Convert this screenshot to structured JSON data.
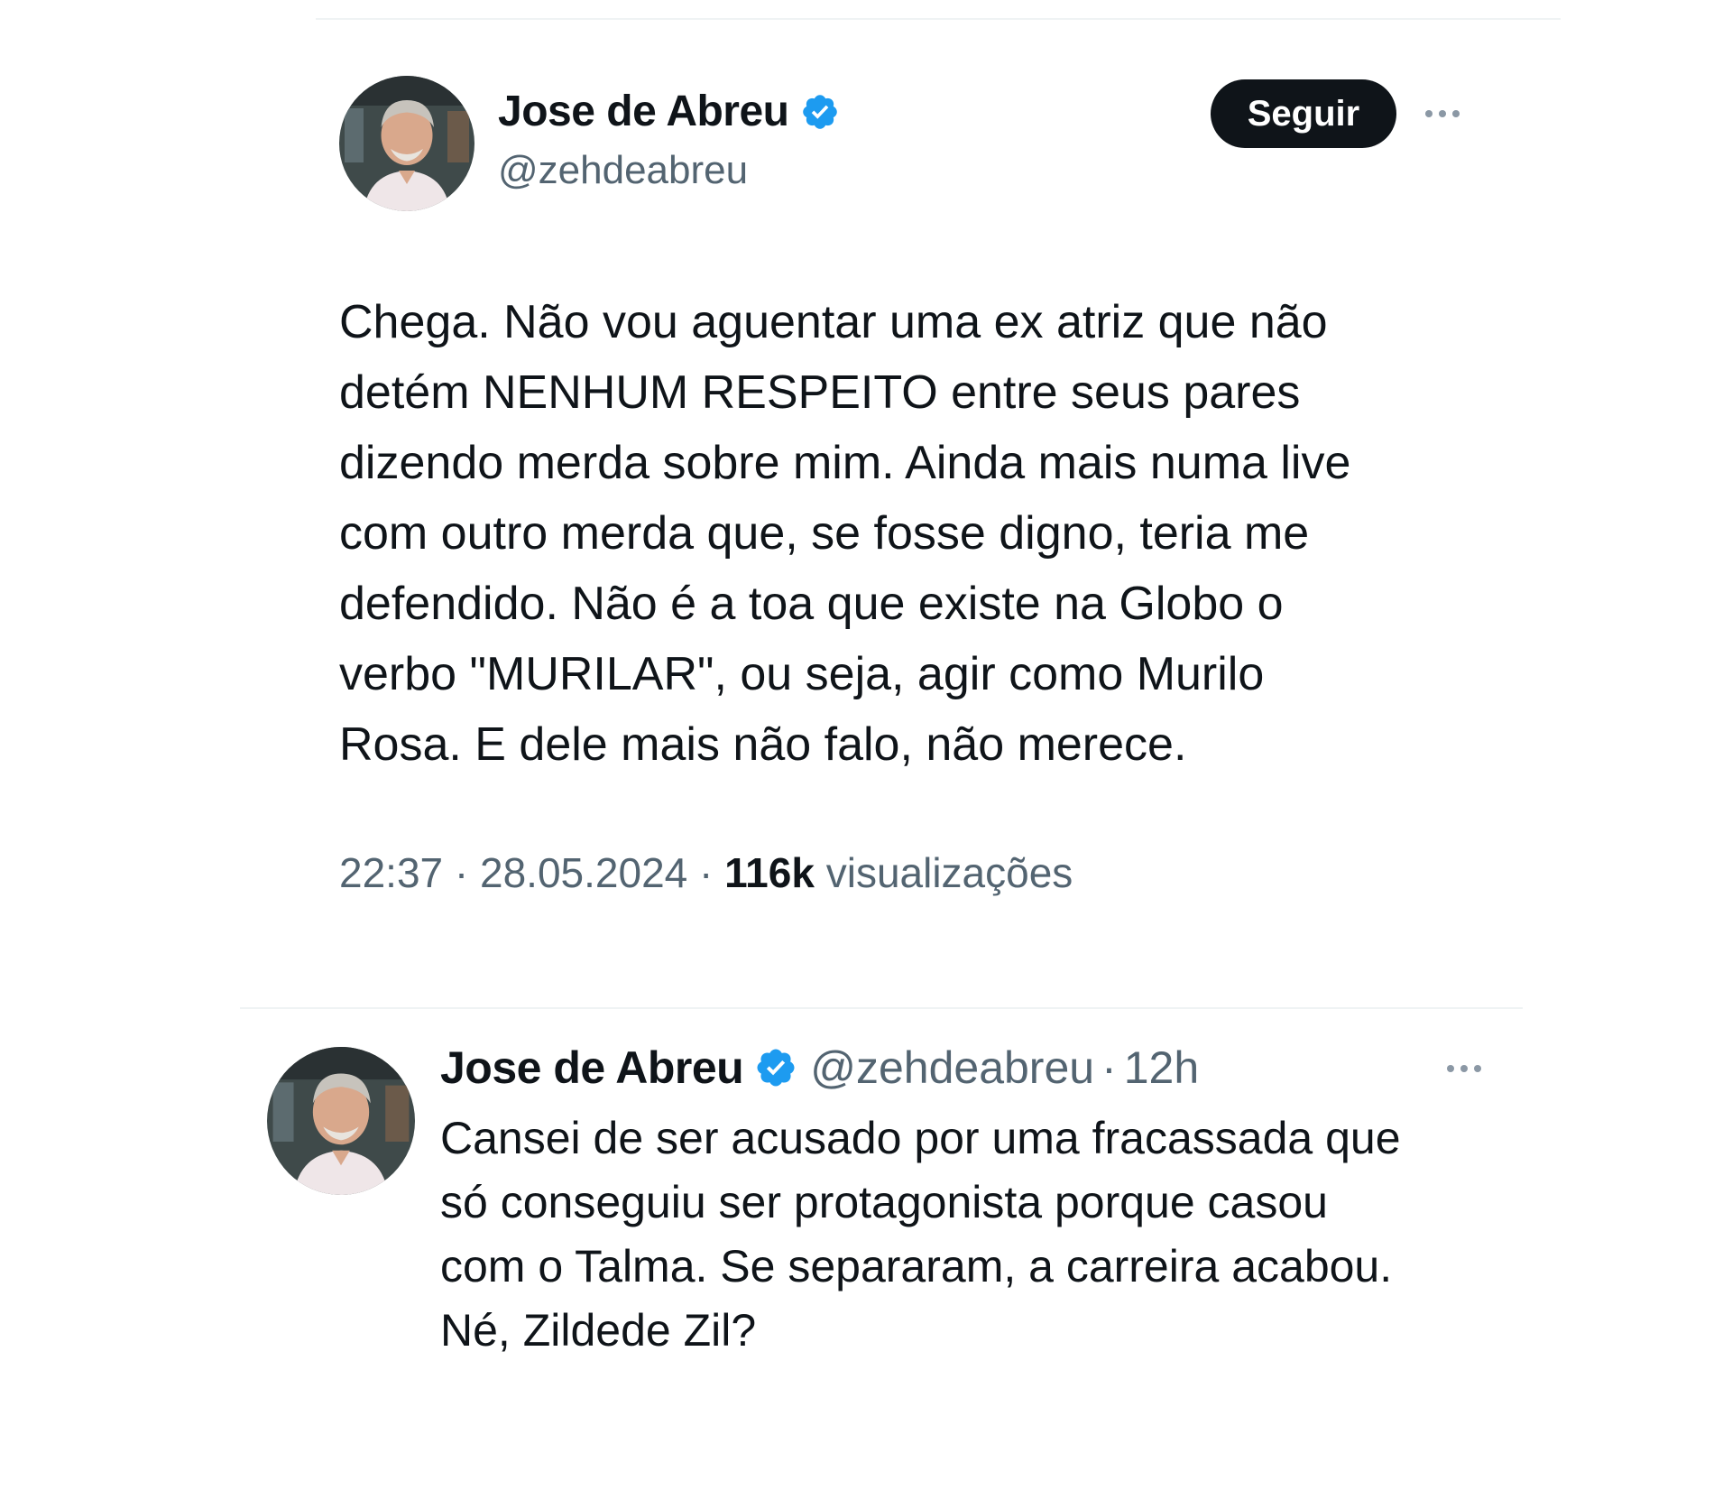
{
  "tweet1": {
    "author_name": "Jose de Abreu",
    "handle": "@zehdeabreu",
    "follow_label": "Seguir",
    "body_lines": [
      "Chega. Não vou aguentar uma ex atriz que não",
      "detém NENHUM RESPEITO entre seus pares",
      "dizendo merda sobre mim. Ainda mais numa live",
      "com outro merda que,  se fosse digno, teria me",
      "defendido. Não é a toa que existe na Globo o",
      "verbo \"MURILAR\",  ou seja, agir como Murilo",
      "Rosa. E dele mais não falo, não merece."
    ],
    "time": "22:37",
    "separator": "·",
    "date": "28.05.2024",
    "views_count": "116k",
    "views_label": "visualizações"
  },
  "tweet2": {
    "author_name": "Jose de Abreu",
    "handle": "@zehdeabreu",
    "separator": "·",
    "time_ago": "12h",
    "body_lines": [
      "Cansei de ser acusado por uma fracassada que",
      "só conseguiu ser protagonista porque casou",
      "com o Talma. Se separaram, a carreira acabou.",
      "Né, Zildede Zil?"
    ]
  },
  "icons": {
    "verified": "verified-badge-icon",
    "more": "more-options-icon"
  },
  "colors": {
    "verified_blue": "#1d9bf0",
    "secondary_text": "#536471",
    "primary_text": "#0f1419",
    "follow_button_bg": "#0f1419"
  }
}
